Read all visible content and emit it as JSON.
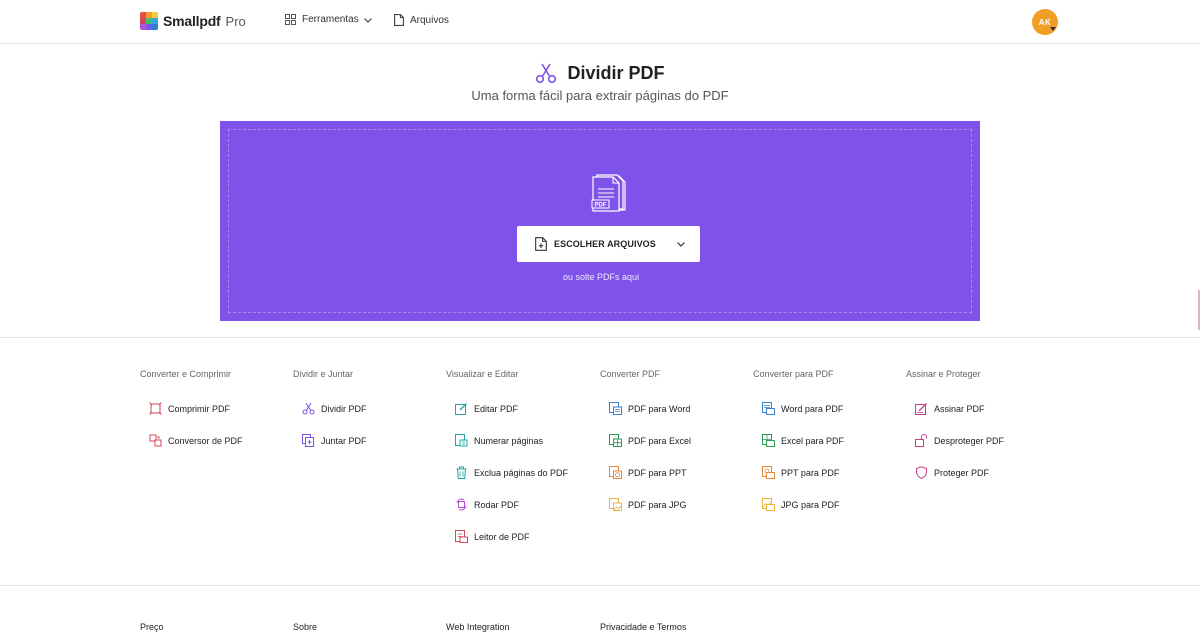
{
  "header": {
    "brand": "Smallpdf",
    "brand_tier": "Pro",
    "nav_tools": "Ferramentas",
    "nav_files": "Arquivos",
    "avatar_initials": "AK"
  },
  "hero": {
    "title": "Dividir PDF",
    "subtitle": "Uma forma fácil para extrair páginas do PDF",
    "choose_button": "ESCOLHER ARQUIVOS",
    "drop_hint": "ou solte PDFs aqui",
    "illustration_label": "PDF",
    "accent_color": "#7f52e9"
  },
  "tool_columns": [
    {
      "heading": "Converter e Comprimir",
      "items": [
        {
          "label": "Comprimir PDF",
          "icon": "compress-icon",
          "color": "#d6465a"
        },
        {
          "label": "Conversor de PDF",
          "icon": "convert-icon",
          "color": "#d6465a"
        }
      ]
    },
    {
      "heading": "Dividir e Juntar",
      "items": [
        {
          "label": "Dividir PDF",
          "icon": "scissors-icon",
          "color": "#8052e8"
        },
        {
          "label": "Juntar PDF",
          "icon": "merge-icon",
          "color": "#8052e8"
        }
      ]
    },
    {
      "heading": "Visualizar e Editar",
      "items": [
        {
          "label": "Editar PDF",
          "icon": "edit-icon",
          "color": "#21a4a8"
        },
        {
          "label": "Numerar páginas",
          "icon": "page-numbers-icon",
          "color": "#21a4a8"
        },
        {
          "label": "Exclua páginas do PDF",
          "icon": "trash-icon",
          "color": "#21a4a8"
        },
        {
          "label": "Rodar PDF",
          "icon": "rotate-icon",
          "color": "#b152d8"
        },
        {
          "label": "Leitor de PDF",
          "icon": "reader-icon",
          "color": "#d6465a"
        }
      ]
    },
    {
      "heading": "Converter PDF",
      "items": [
        {
          "label": "PDF para Word",
          "icon": "pdf-to-word-icon",
          "color": "#3b82c8"
        },
        {
          "label": "PDF para Excel",
          "icon": "pdf-to-excel-icon",
          "color": "#2e9c52"
        },
        {
          "label": "PDF para PPT",
          "icon": "pdf-to-ppt-icon",
          "color": "#e28a3a"
        },
        {
          "label": "PDF para JPG",
          "icon": "pdf-to-jpg-icon",
          "color": "#e9b53b"
        }
      ]
    },
    {
      "heading": "Converter para PDF",
      "items": [
        {
          "label": "Word para PDF",
          "icon": "word-to-pdf-icon",
          "color": "#3b82c8"
        },
        {
          "label": "Excel para PDF",
          "icon": "excel-to-pdf-icon",
          "color": "#2e9c52"
        },
        {
          "label": "PPT para PDF",
          "icon": "ppt-to-pdf-icon",
          "color": "#e28a3a"
        },
        {
          "label": "JPG para PDF",
          "icon": "jpg-to-pdf-icon",
          "color": "#e9b53b"
        }
      ]
    },
    {
      "heading": "Assinar e Proteger",
      "items": [
        {
          "label": "Assinar PDF",
          "icon": "sign-icon",
          "color": "#c83c8a"
        },
        {
          "label": "Desproteger PDF",
          "icon": "unlock-icon",
          "color": "#c83c8a"
        },
        {
          "label": "Proteger PDF",
          "icon": "shield-icon",
          "color": "#c83c8a"
        }
      ]
    }
  ],
  "footer": {
    "links": [
      "Preço",
      "Sobre",
      "Web Integration",
      "Privacidade e Termos"
    ]
  }
}
